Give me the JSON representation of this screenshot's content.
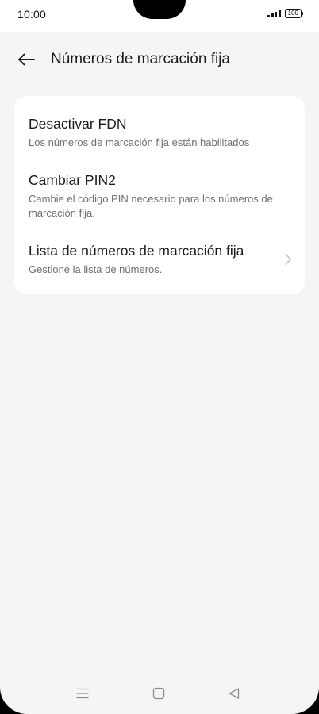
{
  "status_bar": {
    "time": "10:00",
    "battery": "100"
  },
  "header": {
    "title": "Números de marcación fija"
  },
  "settings": {
    "items": [
      {
        "title": "Desactivar FDN",
        "subtitle": "Los números de marcación fija están habilitados"
      },
      {
        "title": "Cambiar PIN2",
        "subtitle": "Cambie el código PIN necesario para los números de marcación fija."
      },
      {
        "title": "Lista de números de marcación fija",
        "subtitle": "Gestione la lista de números."
      }
    ]
  },
  "icons": {
    "back": "arrow-left-icon",
    "chevron": "chevron-right-icon",
    "nav_menu": "menu-icon",
    "nav_home": "square-icon",
    "nav_back": "triangle-back-icon"
  },
  "colors": {
    "background": "#f5f5f5",
    "card": "#ffffff",
    "text_primary": "#1a1a1a",
    "text_secondary": "#6f6f6f"
  }
}
